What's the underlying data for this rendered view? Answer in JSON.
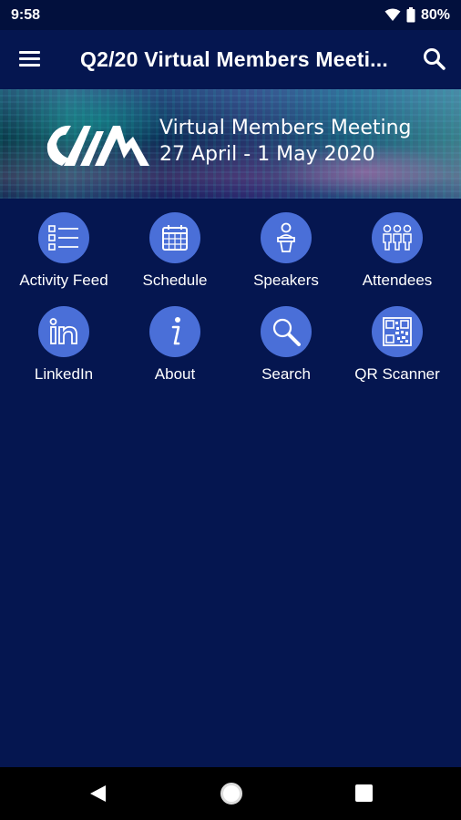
{
  "status_bar": {
    "time": "9:58",
    "battery": "80%",
    "wifi_icon": "wifi-icon",
    "battery_icon": "battery-icon"
  },
  "app_bar": {
    "title": "Q2/20 Virtual Members Meeti...",
    "menu_icon": "hamburger-menu-icon",
    "search_icon": "search-icon"
  },
  "banner": {
    "line1": "Virtual Members Meeting",
    "line2": "27 April - 1 May 2020"
  },
  "tiles": [
    {
      "label": "Activity Feed",
      "icon": "activity-feed-icon"
    },
    {
      "label": "Schedule",
      "icon": "calendar-icon"
    },
    {
      "label": "Speakers",
      "icon": "speaker-podium-icon"
    },
    {
      "label": "Attendees",
      "icon": "people-icon"
    },
    {
      "label": "LinkedIn",
      "icon": "linkedin-icon"
    },
    {
      "label": "About",
      "icon": "info-icon"
    },
    {
      "label": "Search",
      "icon": "magnifier-icon"
    },
    {
      "label": "QR Scanner",
      "icon": "qr-code-icon"
    }
  ],
  "colors": {
    "background": "#051650",
    "status_bar": "#02103d",
    "tile_circle": "#4a6fd8",
    "nav_bar": "#000000"
  },
  "nav_bar": {
    "back_icon": "back-triangle-icon",
    "home_icon": "home-circle-icon",
    "recent_icon": "recent-apps-square-icon"
  }
}
